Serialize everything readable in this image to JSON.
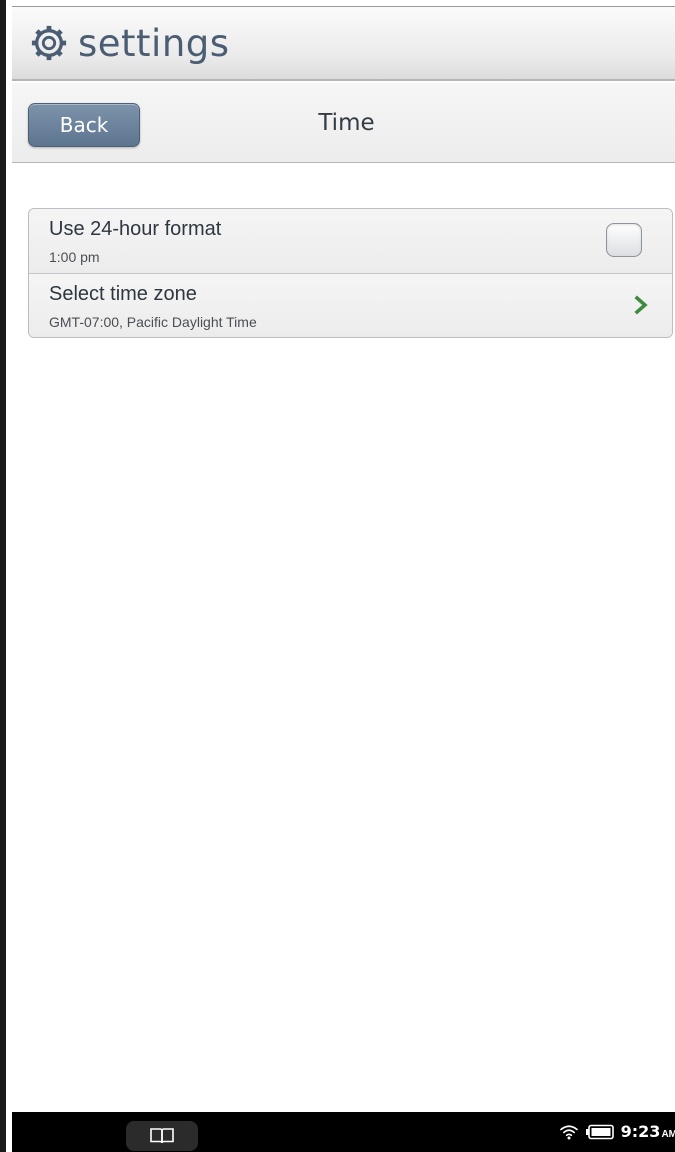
{
  "app": {
    "title": "settings",
    "icon": "gear-icon"
  },
  "subheader": {
    "back_label": "Back",
    "title": "Time"
  },
  "settings": [
    {
      "title": "Use 24-hour format",
      "subtitle": "1:00 pm",
      "control": "checkbox",
      "checked": false
    },
    {
      "title": "Select time zone",
      "subtitle": "GMT-07:00, Pacific Daylight Time",
      "control": "chevron-right-icon"
    }
  ],
  "status_bar": {
    "library_icon": "book-icon",
    "wifi_icon": "wifi-icon",
    "battery_icon": "battery-icon",
    "time": "9:23",
    "ampm": "AM"
  },
  "colors": {
    "accent": "#5e7590",
    "title_text": "#4b5d72",
    "chevron": "#3f8a3c"
  }
}
